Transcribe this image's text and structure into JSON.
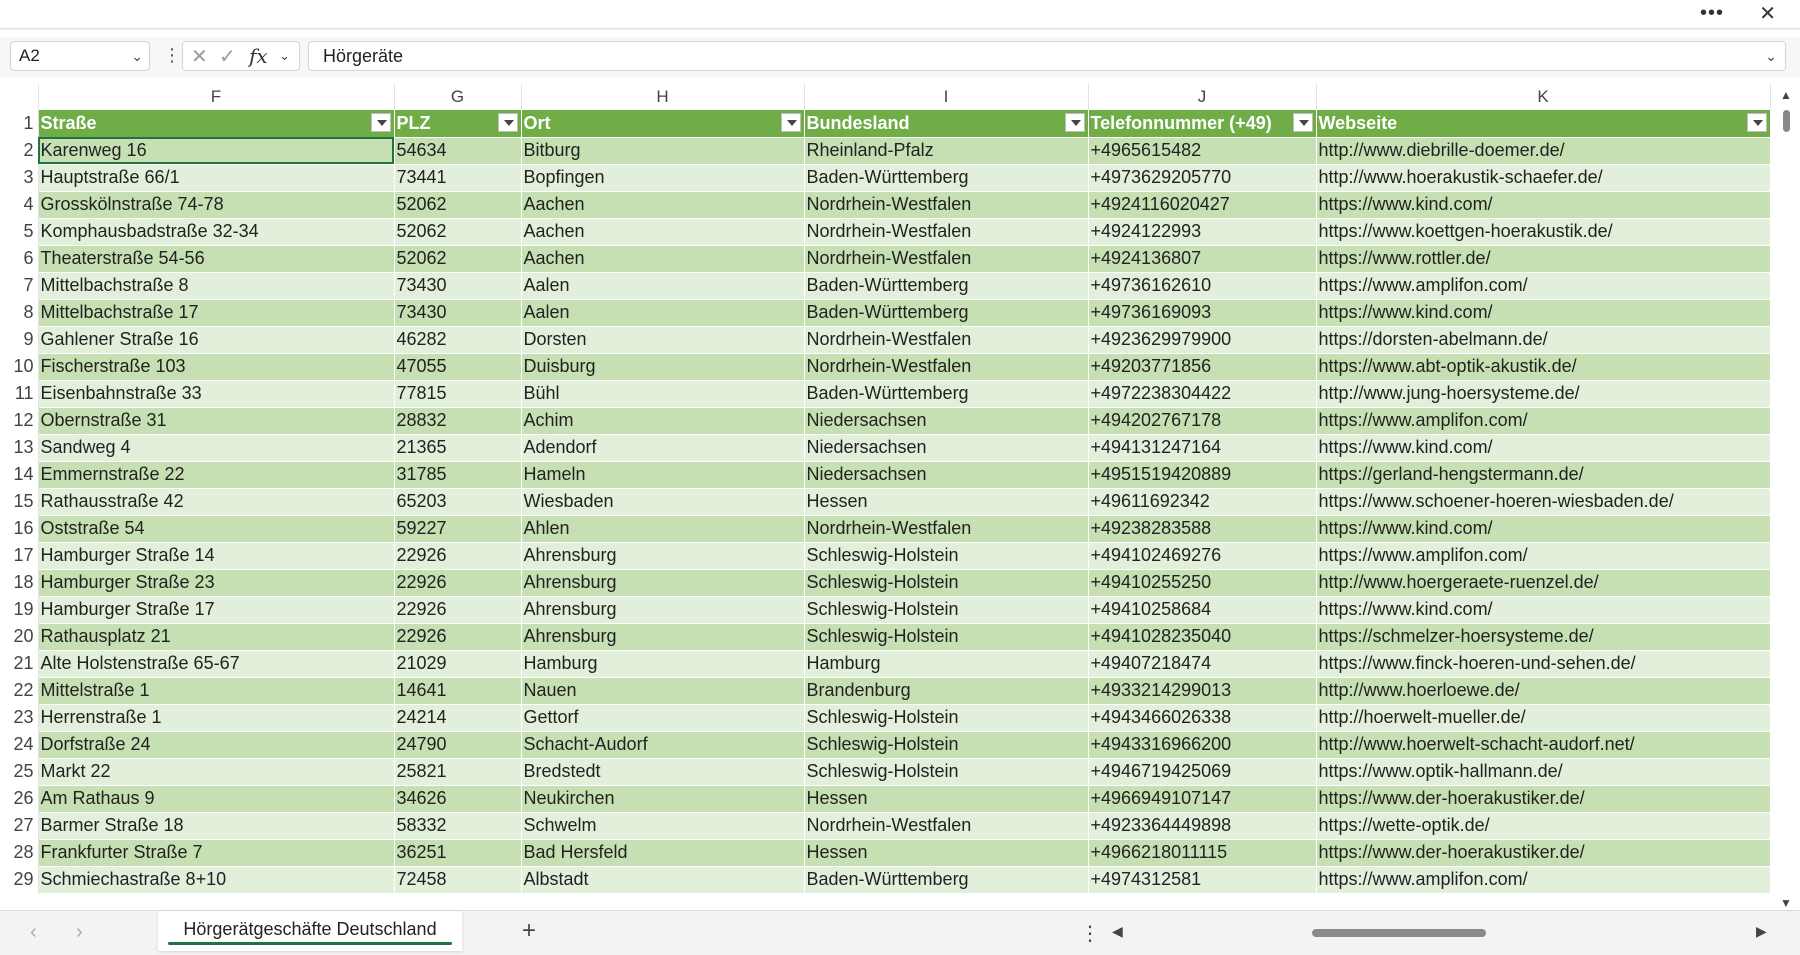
{
  "window": {
    "more_label": "•••",
    "close_label": "✕"
  },
  "formula_bar": {
    "name_box": "A2",
    "cancel_icon": "✕",
    "enter_icon": "✓",
    "fx_label": "fx",
    "value": "Hörgeräte"
  },
  "columns": [
    "F",
    "G",
    "H",
    "I",
    "J",
    "K"
  ],
  "header_row": {
    "num": "1",
    "cells": [
      "Straße",
      "PLZ",
      "Ort",
      "Bundesland",
      "Telefonnummer (+49)",
      "Webseite"
    ]
  },
  "rows": [
    {
      "num": "2",
      "cells": [
        "Karenweg 16",
        "54634",
        "Bitburg",
        "Rheinland-Pfalz",
        "+4965615482",
        "http://www.diebrille-doemer.de/"
      ]
    },
    {
      "num": "3",
      "cells": [
        "Hauptstraße 66/1",
        "73441",
        "Bopfingen",
        "Baden-Württemberg",
        "+4973629205770",
        "http://www.hoerakustik-schaefer.de/"
      ]
    },
    {
      "num": "4",
      "cells": [
        "Grosskölnstraße 74-78",
        "52062",
        "Aachen",
        "Nordrhein-Westfalen",
        "+4924116020427",
        "https://www.kind.com/"
      ]
    },
    {
      "num": "5",
      "cells": [
        "Komphausbadstraße 32-34",
        "52062",
        "Aachen",
        "Nordrhein-Westfalen",
        "+4924122993",
        "https://www.koettgen-hoerakustik.de/"
      ]
    },
    {
      "num": "6",
      "cells": [
        "Theaterstraße 54-56",
        "52062",
        "Aachen",
        "Nordrhein-Westfalen",
        "+4924136807",
        "https://www.rottler.de/"
      ]
    },
    {
      "num": "7",
      "cells": [
        "Mittelbachstraße 8",
        "73430",
        "Aalen",
        "Baden-Württemberg",
        "+49736162610",
        "https://www.amplifon.com/"
      ]
    },
    {
      "num": "8",
      "cells": [
        "Mittelbachstraße 17",
        "73430",
        "Aalen",
        "Baden-Württemberg",
        "+49736169093",
        "https://www.kind.com/"
      ]
    },
    {
      "num": "9",
      "cells": [
        "Gahlener Straße 16",
        "46282",
        "Dorsten",
        "Nordrhein-Westfalen",
        "+4923629979900",
        "https://dorsten-abelmann.de/"
      ]
    },
    {
      "num": "10",
      "cells": [
        "Fischerstraße 103",
        "47055",
        "Duisburg",
        "Nordrhein-Westfalen",
        "+49203771856",
        "https://www.abt-optik-akustik.de/"
      ]
    },
    {
      "num": "11",
      "cells": [
        "Eisenbahnstraße 33",
        "77815",
        "Bühl",
        "Baden-Württemberg",
        "+4972238304422",
        "http://www.jung-hoersysteme.de/"
      ]
    },
    {
      "num": "12",
      "cells": [
        "Obernstraße 31",
        "28832",
        "Achim",
        "Niedersachsen",
        "+494202767178",
        "https://www.amplifon.com/"
      ]
    },
    {
      "num": "13",
      "cells": [
        "Sandweg 4",
        "21365",
        "Adendorf",
        "Niedersachsen",
        "+494131247164",
        "https://www.kind.com/"
      ]
    },
    {
      "num": "14",
      "cells": [
        "Emmernstraße 22",
        "31785",
        "Hameln",
        "Niedersachsen",
        "+4951519420889",
        "https://gerland-hengstermann.de/"
      ]
    },
    {
      "num": "15",
      "cells": [
        "Rathausstraße 42",
        "65203",
        "Wiesbaden",
        "Hessen",
        "+49611692342",
        "https://www.schoener-hoeren-wiesbaden.de/"
      ]
    },
    {
      "num": "16",
      "cells": [
        "Oststraße 54",
        "59227",
        "Ahlen",
        "Nordrhein-Westfalen",
        "+49238283588",
        "https://www.kind.com/"
      ]
    },
    {
      "num": "17",
      "cells": [
        "Hamburger Straße 14",
        "22926",
        "Ahrensburg",
        "Schleswig-Holstein",
        "+494102469276",
        "https://www.amplifon.com/"
      ]
    },
    {
      "num": "18",
      "cells": [
        "Hamburger Straße 23",
        "22926",
        "Ahrensburg",
        "Schleswig-Holstein",
        "+49410255250",
        "http://www.hoergeraete-ruenzel.de/"
      ]
    },
    {
      "num": "19",
      "cells": [
        "Hamburger Straße 17",
        "22926",
        "Ahrensburg",
        "Schleswig-Holstein",
        "+49410258684",
        "https://www.kind.com/"
      ]
    },
    {
      "num": "20",
      "cells": [
        "Rathausplatz 21",
        "22926",
        "Ahrensburg",
        "Schleswig-Holstein",
        "+4941028235040",
        "https://schmelzer-hoersysteme.de/"
      ]
    },
    {
      "num": "21",
      "cells": [
        "Alte Holstenstraße 65-67",
        "21029",
        "Hamburg",
        "Hamburg",
        "+49407218474",
        "https://www.finck-hoeren-und-sehen.de/"
      ]
    },
    {
      "num": "22",
      "cells": [
        "Mittelstraße 1",
        "14641",
        "Nauen",
        "Brandenburg",
        "+4933214299013",
        "http://www.hoerloewe.de/"
      ]
    },
    {
      "num": "23",
      "cells": [
        "Herrenstraße 1",
        "24214",
        "Gettorf",
        "Schleswig-Holstein",
        "+4943466026338",
        "http://hoerwelt-mueller.de/"
      ]
    },
    {
      "num": "24",
      "cells": [
        "Dorfstraße 24",
        "24790",
        "Schacht-Audorf",
        "Schleswig-Holstein",
        "+4943316966200",
        "http://www.hoerwelt-schacht-audorf.net/"
      ]
    },
    {
      "num": "25",
      "cells": [
        "Markt 22",
        "25821",
        "Bredstedt",
        "Schleswig-Holstein",
        "+4946719425069",
        "https://www.optik-hallmann.de/"
      ]
    },
    {
      "num": "26",
      "cells": [
        "Am Rathaus 9",
        "34626",
        "Neukirchen",
        "Hessen",
        "+4966949107147",
        "https://www.der-hoerakustiker.de/"
      ]
    },
    {
      "num": "27",
      "cells": [
        "Barmer Straße 18",
        "58332",
        "Schwelm",
        "Nordrhein-Westfalen",
        "+4923364449898",
        "https://wette-optik.de/"
      ]
    },
    {
      "num": "28",
      "cells": [
        "Frankfurter Straße 7",
        "36251",
        "Bad Hersfeld",
        "Hessen",
        "+4966218011115",
        "https://www.der-hoerakustiker.de/"
      ]
    },
    {
      "num": "29",
      "cells": [
        "Schmiechastraße 8+10",
        "72458",
        "Albstadt",
        "Baden-Württemberg",
        "+4974312581",
        "https://www.amplifon.com/"
      ]
    }
  ],
  "sheet_tabs": [
    {
      "label": "Hörgerätgeschäfte Deutschland",
      "active": true
    }
  ],
  "bottom": {
    "add_sheet": "+",
    "nav_prev": "‹",
    "nav_next": "›",
    "more": "⋮"
  },
  "colors": {
    "header_green": "#70ad47",
    "band_dark": "#c6e0b4",
    "band_light": "#e2efda",
    "accent": "#217346"
  }
}
